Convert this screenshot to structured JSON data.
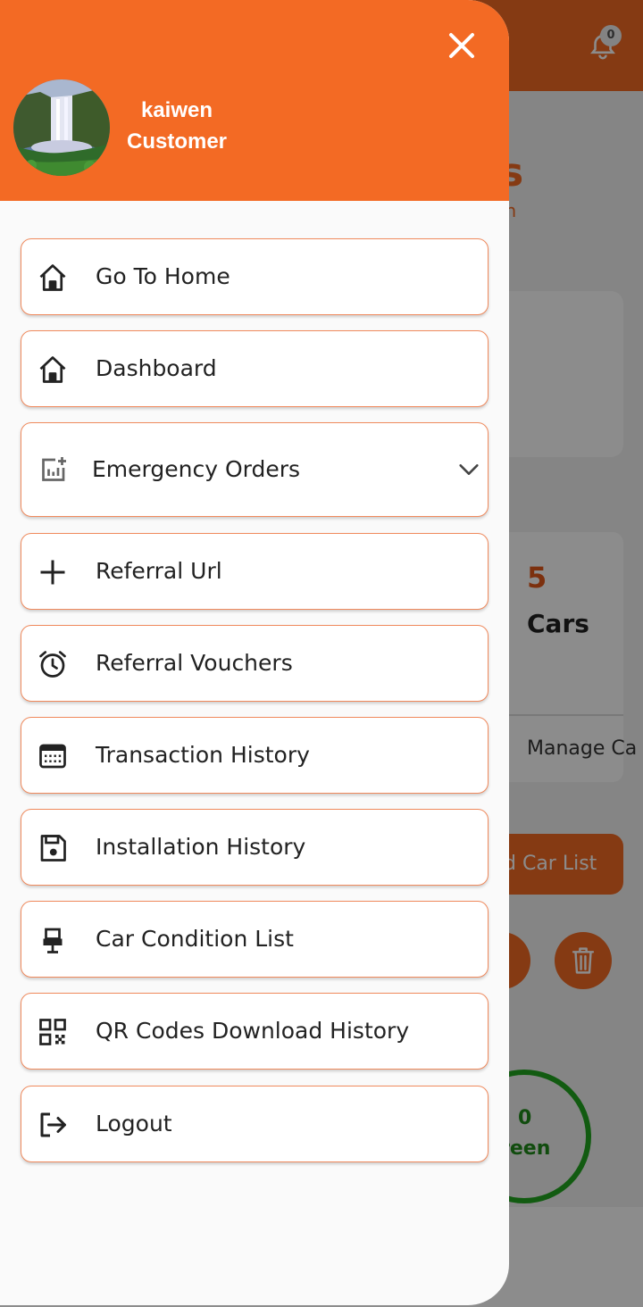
{
  "background": {
    "notification_count": "0",
    "brand_fragment": "s",
    "brand_sub_fragment": "in",
    "car_count": "5",
    "cars_label": "Cars",
    "manage_label": "Manage Ca",
    "car_list_button": "d Car List",
    "ring_value": "0",
    "ring_label": "reen"
  },
  "drawer": {
    "user": {
      "name": "kaiwen",
      "role": "Customer"
    },
    "menu": {
      "go_home": "Go To Home",
      "dashboard": "Dashboard",
      "emergency_orders": "Emergency Orders",
      "referral_url": "Referral Url",
      "referral_vouchers": "Referral Vouchers",
      "transaction_history": "Transaction History",
      "installation_history": "Installation History",
      "car_condition_list": "Car Condition List",
      "qr_codes_history": "QR Codes Download History",
      "logout": "Logout"
    }
  },
  "colors": {
    "accent": "#f36a24",
    "item_border": "#f08a5d",
    "ring": "#22a61f"
  },
  "icons": {
    "close": "close-icon",
    "home": "home-icon",
    "dashboard": "home-icon",
    "emergency": "chart-add-icon",
    "referral_url": "plus-icon",
    "vouchers": "alarm-clock-icon",
    "transactions": "calendar-icon",
    "installation": "floppy-disk-icon",
    "car_condition": "car-seat-icon",
    "qr": "qr-code-icon",
    "logout": "logout-icon",
    "expand": "chevron-down-icon"
  }
}
